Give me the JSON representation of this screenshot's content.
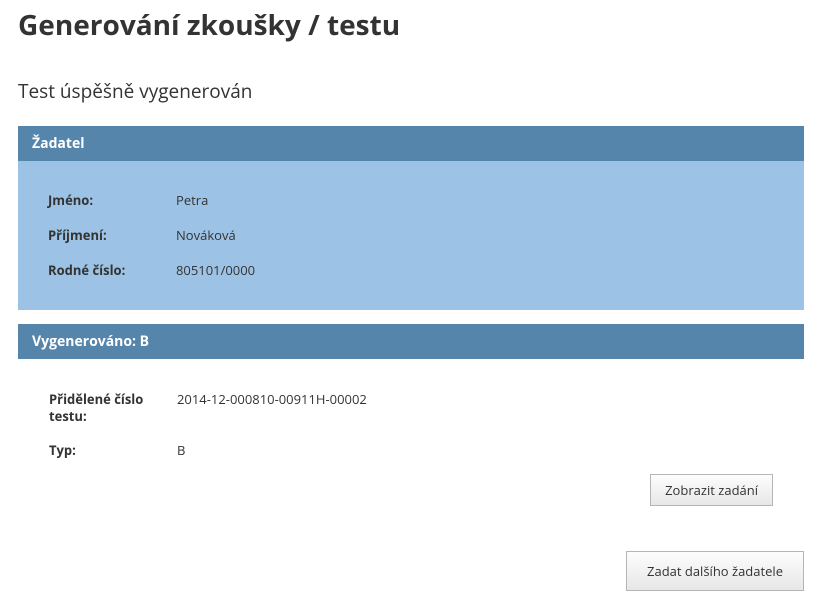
{
  "title": "Generování zkoušky / testu",
  "status": "Test úspěšně vygenerován",
  "applicant": {
    "header": "Žadatel",
    "fields": {
      "first_name_label": "Jméno:",
      "first_name_value": "Petra",
      "last_name_label": "Příjmení:",
      "last_name_value": "Nováková",
      "birth_no_label": "Rodné číslo:",
      "birth_no_value": "805101/0000"
    }
  },
  "generated": {
    "header": "Vygenerováno: B",
    "fields": {
      "test_no_label": "Přidělené číslo testu:",
      "test_no_value": "2014-12-000810-00911H-00002",
      "type_label": "Typ:",
      "type_value": "B"
    },
    "show_button": "Zobrazit zadání"
  },
  "footer": {
    "next_button": "Zadat dalšího žadatele"
  }
}
